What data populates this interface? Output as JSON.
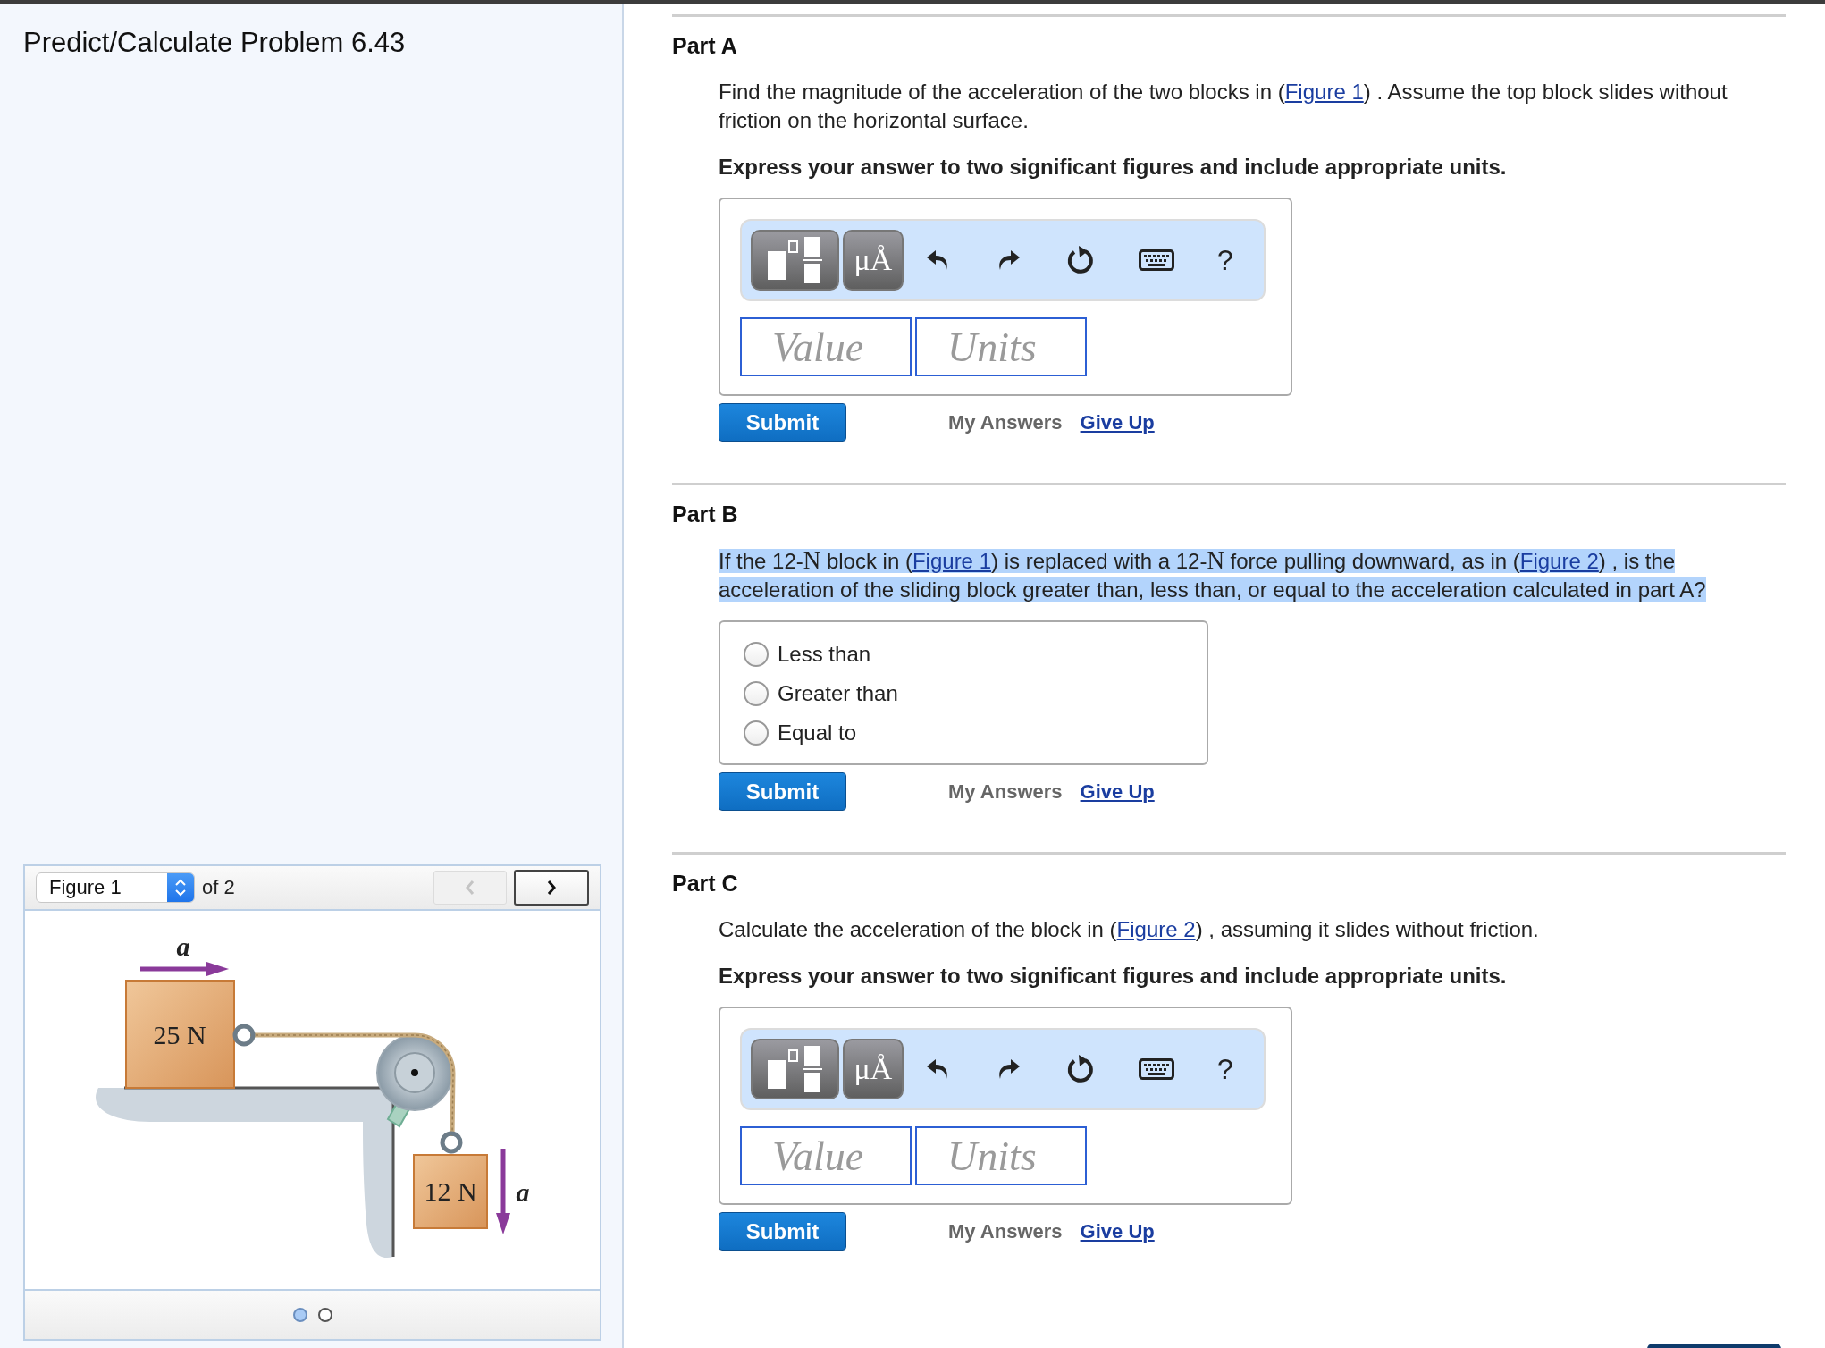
{
  "title": "Predict/Calculate Problem 6.43",
  "figure_viewer": {
    "selector": "Figure 1",
    "count": "of 2",
    "prev_disabled": true,
    "top_arrow_label": "a",
    "top_block_label": "25 N",
    "hanging_block_label": "12 N",
    "side_arrow_label": "a",
    "pages": [
      {
        "selected": true
      },
      {
        "selected": false
      }
    ]
  },
  "parts": [
    {
      "heading": "Part A",
      "highlighted": false,
      "prompt": [
        {
          "kind": "text",
          "text": "Find the magnitude of the acceleration of the two blocks in ("
        },
        {
          "kind": "link",
          "text": "Figure 1"
        },
        {
          "kind": "text",
          "text": ") . Assume the top block slides without friction on the horizontal surface."
        }
      ],
      "instruction": "Express your answer to two significant figures and include appropriate units.",
      "answer": {
        "kind": "numeric",
        "units_button": "μÅ",
        "help": "?",
        "value_placeholder": "Value",
        "units_placeholder": "Units"
      },
      "actions": {
        "submit": "Submit",
        "my_answers": "My Answers",
        "give_up": "Give Up"
      }
    },
    {
      "heading": "Part B",
      "highlighted": true,
      "prompt": [
        {
          "kind": "text",
          "text": "If the 12-"
        },
        {
          "kind": "symbol",
          "text": "N"
        },
        {
          "kind": "text",
          "text": " block in ("
        },
        {
          "kind": "link",
          "text": "Figure 1"
        },
        {
          "kind": "text",
          "text": ") is replaced with a 12-"
        },
        {
          "kind": "symbol",
          "text": "N"
        },
        {
          "kind": "text",
          "text": " force pulling downward, as in ("
        },
        {
          "kind": "link",
          "text": "Figure 2"
        },
        {
          "kind": "text",
          "text": ") , is the acceleration of the sliding block greater than, less than, or equal to the acceleration calculated in part A?"
        }
      ],
      "answer": {
        "kind": "choice",
        "options": [
          {
            "label": "Less than",
            "selected": false
          },
          {
            "label": "Greater than",
            "selected": false
          },
          {
            "label": "Equal to",
            "selected": false
          }
        ]
      },
      "actions": {
        "submit": "Submit",
        "my_answers": "My Answers",
        "give_up": "Give Up"
      }
    },
    {
      "heading": "Part C",
      "highlighted": false,
      "prompt": [
        {
          "kind": "text",
          "text": "Calculate the acceleration of the block in ("
        },
        {
          "kind": "link",
          "text": "Figure 2"
        },
        {
          "kind": "text",
          "text": ") , assuming it slides without friction."
        }
      ],
      "instruction": "Express your answer to two significant figures and include appropriate units.",
      "answer": {
        "kind": "numeric",
        "units_button": "μÅ",
        "help": "?",
        "value_placeholder": "Value",
        "units_placeholder": "Units"
      },
      "actions": {
        "submit": "Submit",
        "my_answers": "My Answers",
        "give_up": "Give Up"
      }
    }
  ]
}
